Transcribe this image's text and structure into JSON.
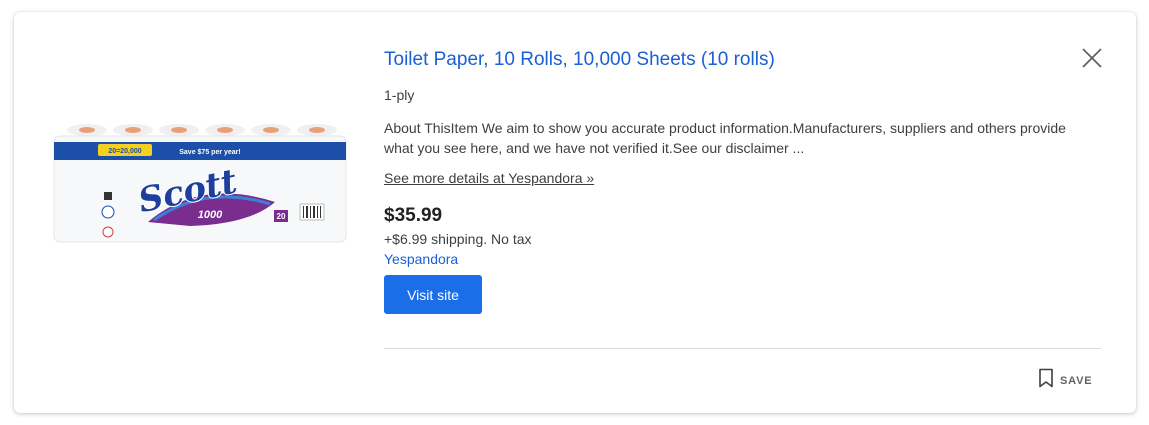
{
  "product": {
    "title": "Toilet Paper, 10 Rolls, 10,000 Sheets (10 rolls)",
    "subtitle": "1-ply",
    "description": "About ThisItem We aim to show you accurate product information.Manufacturers, suppliers and others provide what you see here, and we have not verified it.See our disclaimer ...",
    "more_link": "See more details at Yespandora »",
    "price": "$35.99",
    "shipping": "+$6.99 shipping. No tax",
    "seller": "Yespandora",
    "visit_button": "Visit site",
    "save_label": "SAVE",
    "image": {
      "brand": "Scott",
      "count_badge": "1000",
      "top_banner": "20=20,000",
      "promo": "Save $75 per year!",
      "roll_badge": "20"
    }
  },
  "icons": {
    "close": "close-icon",
    "save": "bookmark-icon"
  },
  "colors": {
    "link": "#1a5fd6",
    "button": "#1a6ee8",
    "text": "#3c4043",
    "price": "#202124"
  }
}
